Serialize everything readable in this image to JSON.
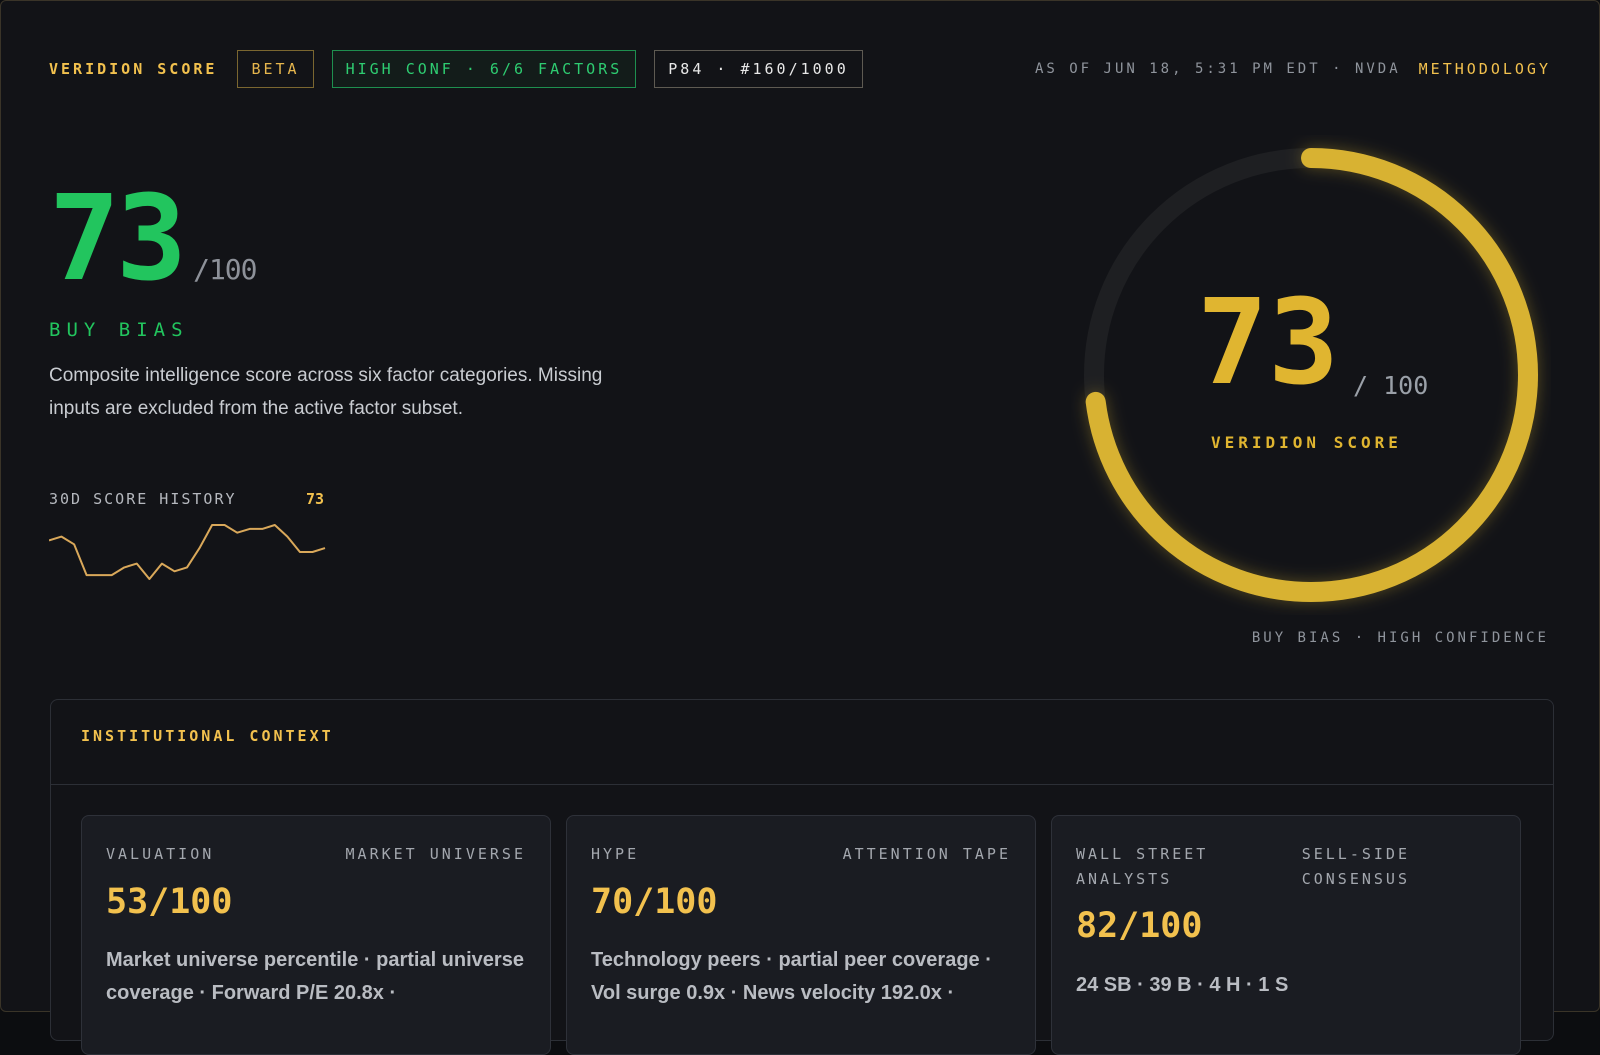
{
  "header": {
    "brand": "VERIDION SCORE",
    "beta_badge": "BETA",
    "confidence_badge": "HIGH CONF · 6/6 FACTORS",
    "rank_badge": "P84 · #160/1000",
    "as_of": "AS OF JUN 18, 5:31 PM EDT · NVDA",
    "methodology_link": "METHODOLOGY"
  },
  "score": {
    "value": "73",
    "denominator": "/100",
    "bias_label": "BUY BIAS",
    "description": "Composite intelligence score across six factor categories. Missing inputs are excluded from the active factor subset."
  },
  "history": {
    "label": "30D SCORE HISTORY",
    "latest": "73",
    "values": [
      72,
      73,
      71,
      63,
      63,
      63,
      65,
      66,
      62,
      66,
      64,
      65,
      70,
      76,
      76,
      74,
      75,
      75,
      76,
      73,
      69,
      69,
      70
    ]
  },
  "gauge": {
    "value": "73",
    "denominator": "/ 100",
    "label": "VERIDION SCORE",
    "fill_fraction": 0.73,
    "footer": "BUY BIAS · HIGH CONFIDENCE"
  },
  "institutional": {
    "title": "INSTITUTIONAL CONTEXT",
    "cards": [
      {
        "category": "VALUATION",
        "source": "MARKET UNIVERSE",
        "score": "53/100",
        "body": "Market universe percentile · partial universe coverage · Forward P/E 20.8x ·"
      },
      {
        "category": "HYPE",
        "source": "ATTENTION TAPE",
        "score": "70/100",
        "body": "Technology peers · partial peer coverage · Vol surge 0.9x · News velocity 192.0x ·"
      },
      {
        "category": "WALL STREET\nANALYSTS",
        "source": "SELL-SIDE\nCONSENSUS",
        "score": "82/100",
        "body": "24 SB · 39 B · 4 H · 1 S"
      }
    ]
  },
  "colors": {
    "accent_gold": "#e0b530",
    "buy_green": "#22c55e",
    "background": "#121317"
  }
}
